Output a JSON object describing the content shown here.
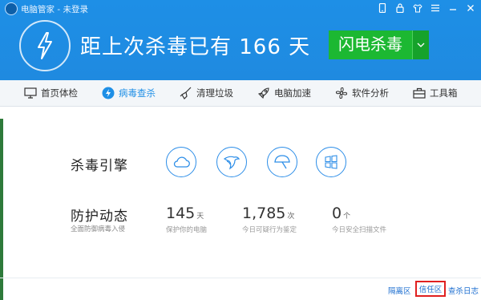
{
  "window": {
    "title": "电脑管家 - 未登录"
  },
  "header": {
    "headline": "距上次杀毒已有 166 天",
    "scan_button": "闪电杀毒"
  },
  "nav": {
    "items": [
      {
        "label": "首页体检",
        "active": false
      },
      {
        "label": "病毒查杀",
        "active": true
      },
      {
        "label": "清理垃圾",
        "active": false
      },
      {
        "label": "电脑加速",
        "active": false
      },
      {
        "label": "软件分析",
        "active": false
      },
      {
        "label": "工具箱",
        "active": false
      }
    ]
  },
  "engine": {
    "label": "杀毒引擎",
    "icons": [
      "cloud-icon",
      "eagle-icon",
      "umbrella-icon",
      "windows-icon"
    ]
  },
  "protection": {
    "label": "防护动态",
    "subtitle": "全面防御病毒入侵",
    "stats": [
      {
        "value": "145",
        "unit": "天",
        "desc": "保护你的电脑"
      },
      {
        "value": "1,785",
        "unit": "次",
        "desc": "今日可疑行为鉴定"
      },
      {
        "value": "0",
        "unit": "个",
        "desc": "今日安全扫描文件"
      }
    ]
  },
  "footer": {
    "quarantine": "隔离区",
    "trust_zone": "信任区",
    "log": "查杀日志"
  },
  "colors": {
    "header_bg": "#1e8fe6",
    "scan_green": "#1cb832",
    "active_nav": "#1e8fe6",
    "highlight_red": "#e02020"
  }
}
